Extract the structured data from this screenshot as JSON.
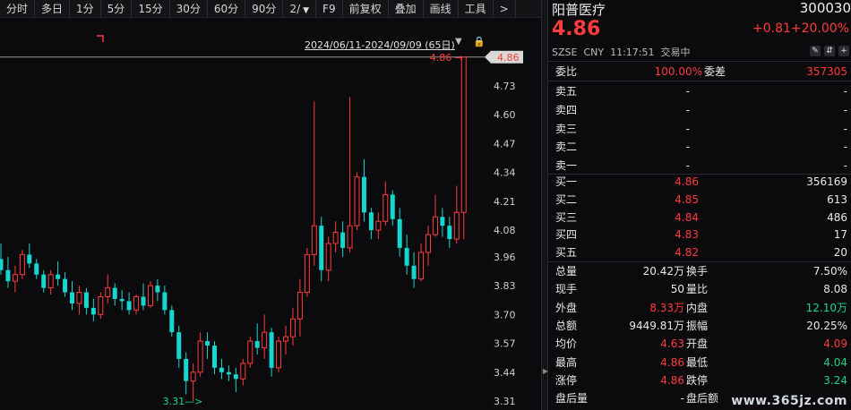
{
  "toolbar": {
    "items": [
      "分时",
      "多日",
      "1分",
      "5分",
      "15分",
      "30分",
      "60分",
      "90分",
      "2/",
      "F9",
      "前复权",
      "叠加",
      "画线",
      "工具",
      ">"
    ]
  },
  "chart": {
    "range_label": "2024/06/11-2024/09/09 (65日)",
    "dropdown_icon": "dropdown-arrow",
    "lock_icon": "lock-icon",
    "current_price_tag": "4.86",
    "high_marker": "4.86",
    "low_marker": "3.31",
    "colors": {
      "up": "#ff3b3b",
      "down": "#16d6d0",
      "background": "#0b0b0d"
    }
  },
  "chart_data": {
    "type": "candlestick",
    "y_ticks": [
      "4.73",
      "4.60",
      "4.47",
      "4.34",
      "4.21",
      "4.08",
      "3.96",
      "3.83",
      "3.70",
      "3.57",
      "3.44",
      "3.31"
    ],
    "ylim": [
      3.27,
      4.9
    ],
    "candles": [
      {
        "o": 3.95,
        "h": 4.02,
        "l": 3.88,
        "c": 3.9
      },
      {
        "o": 3.9,
        "h": 3.96,
        "l": 3.82,
        "c": 3.85
      },
      {
        "o": 3.85,
        "h": 3.92,
        "l": 3.8,
        "c": 3.88
      },
      {
        "o": 3.88,
        "h": 3.99,
        "l": 3.86,
        "c": 3.97
      },
      {
        "o": 3.97,
        "h": 4.02,
        "l": 3.91,
        "c": 3.93
      },
      {
        "o": 3.93,
        "h": 3.95,
        "l": 3.86,
        "c": 3.88
      },
      {
        "o": 3.88,
        "h": 3.9,
        "l": 3.8,
        "c": 3.82
      },
      {
        "o": 3.82,
        "h": 3.9,
        "l": 3.79,
        "c": 3.88
      },
      {
        "o": 3.88,
        "h": 3.94,
        "l": 3.83,
        "c": 3.86
      },
      {
        "o": 3.86,
        "h": 3.89,
        "l": 3.78,
        "c": 3.8
      },
      {
        "o": 3.8,
        "h": 3.85,
        "l": 3.72,
        "c": 3.75
      },
      {
        "o": 3.75,
        "h": 3.83,
        "l": 3.7,
        "c": 3.8
      },
      {
        "o": 3.8,
        "h": 3.82,
        "l": 3.7,
        "c": 3.73
      },
      {
        "o": 3.73,
        "h": 3.77,
        "l": 3.67,
        "c": 3.7
      },
      {
        "o": 3.7,
        "h": 3.8,
        "l": 3.68,
        "c": 3.78
      },
      {
        "o": 3.78,
        "h": 3.88,
        "l": 3.75,
        "c": 3.82
      },
      {
        "o": 3.82,
        "h": 3.84,
        "l": 3.74,
        "c": 3.77
      },
      {
        "o": 3.77,
        "h": 3.81,
        "l": 3.72,
        "c": 3.76
      },
      {
        "o": 3.76,
        "h": 3.8,
        "l": 3.7,
        "c": 3.72
      },
      {
        "o": 3.72,
        "h": 3.79,
        "l": 3.7,
        "c": 3.78
      },
      {
        "o": 3.78,
        "h": 3.84,
        "l": 3.72,
        "c": 3.74
      },
      {
        "o": 3.74,
        "h": 3.85,
        "l": 3.73,
        "c": 3.83
      },
      {
        "o": 3.83,
        "h": 3.86,
        "l": 3.76,
        "c": 3.8
      },
      {
        "o": 3.8,
        "h": 3.83,
        "l": 3.7,
        "c": 3.72
      },
      {
        "o": 3.72,
        "h": 3.74,
        "l": 3.6,
        "c": 3.62
      },
      {
        "o": 3.62,
        "h": 3.65,
        "l": 3.46,
        "c": 3.5
      },
      {
        "o": 3.5,
        "h": 3.53,
        "l": 3.34,
        "c": 3.4
      },
      {
        "o": 3.4,
        "h": 3.48,
        "l": 3.31,
        "c": 3.44
      },
      {
        "o": 3.44,
        "h": 3.62,
        "l": 3.42,
        "c": 3.58
      },
      {
        "o": 3.58,
        "h": 3.62,
        "l": 3.5,
        "c": 3.56
      },
      {
        "o": 3.56,
        "h": 3.58,
        "l": 3.43,
        "c": 3.46
      },
      {
        "o": 3.46,
        "h": 3.5,
        "l": 3.41,
        "c": 3.44
      },
      {
        "o": 3.44,
        "h": 3.47,
        "l": 3.4,
        "c": 3.43
      },
      {
        "o": 3.43,
        "h": 3.46,
        "l": 3.35,
        "c": 3.41
      },
      {
        "o": 3.41,
        "h": 3.5,
        "l": 3.38,
        "c": 3.48
      },
      {
        "o": 3.48,
        "h": 3.6,
        "l": 3.46,
        "c": 3.58
      },
      {
        "o": 3.58,
        "h": 3.66,
        "l": 3.52,
        "c": 3.55
      },
      {
        "o": 3.55,
        "h": 3.7,
        "l": 3.5,
        "c": 3.62
      },
      {
        "o": 3.62,
        "h": 3.64,
        "l": 3.42,
        "c": 3.46
      },
      {
        "o": 3.46,
        "h": 3.6,
        "l": 3.44,
        "c": 3.58
      },
      {
        "o": 3.58,
        "h": 3.65,
        "l": 3.52,
        "c": 3.6
      },
      {
        "o": 3.6,
        "h": 3.73,
        "l": 3.56,
        "c": 3.68
      },
      {
        "o": 3.68,
        "h": 3.86,
        "l": 3.6,
        "c": 3.8
      },
      {
        "o": 3.8,
        "h": 4.0,
        "l": 3.78,
        "c": 3.97
      },
      {
        "o": 3.97,
        "h": 4.66,
        "l": 3.92,
        "c": 4.1
      },
      {
        "o": 4.1,
        "h": 4.14,
        "l": 3.85,
        "c": 3.9
      },
      {
        "o": 3.9,
        "h": 4.05,
        "l": 3.85,
        "c": 4.02
      },
      {
        "o": 4.02,
        "h": 4.12,
        "l": 3.98,
        "c": 4.07
      },
      {
        "o": 4.07,
        "h": 4.12,
        "l": 3.96,
        "c": 4.0
      },
      {
        "o": 4.0,
        "h": 4.68,
        "l": 3.98,
        "c": 4.1
      },
      {
        "o": 4.1,
        "h": 4.34,
        "l": 4.08,
        "c": 4.32
      },
      {
        "o": 4.32,
        "h": 4.4,
        "l": 4.12,
        "c": 4.16
      },
      {
        "o": 4.16,
        "h": 4.18,
        "l": 4.04,
        "c": 4.08
      },
      {
        "o": 4.08,
        "h": 4.16,
        "l": 4.04,
        "c": 4.12
      },
      {
        "o": 4.12,
        "h": 4.3,
        "l": 4.1,
        "c": 4.24
      },
      {
        "o": 4.24,
        "h": 4.26,
        "l": 4.1,
        "c": 4.13
      },
      {
        "o": 4.13,
        "h": 4.18,
        "l": 3.96,
        "c": 4.0
      },
      {
        "o": 4.0,
        "h": 4.06,
        "l": 3.88,
        "c": 3.92
      },
      {
        "o": 3.92,
        "h": 3.98,
        "l": 3.82,
        "c": 3.86
      },
      {
        "o": 3.86,
        "h": 4.02,
        "l": 3.85,
        "c": 3.98
      },
      {
        "o": 3.98,
        "h": 4.1,
        "l": 3.92,
        "c": 4.06
      },
      {
        "o": 4.06,
        "h": 4.24,
        "l": 4.05,
        "c": 4.14
      },
      {
        "o": 4.14,
        "h": 4.18,
        "l": 4.05,
        "c": 4.1
      },
      {
        "o": 4.1,
        "h": 4.14,
        "l": 4.0,
        "c": 4.04
      },
      {
        "o": 4.04,
        "h": 4.28,
        "l": 4.02,
        "c": 4.16
      },
      {
        "o": 4.16,
        "h": 4.86,
        "l": 4.04,
        "c": 4.86
      }
    ]
  },
  "panel": {
    "name": "阳普医疗",
    "code": "300030",
    "price": "4.86",
    "change": "+0.81",
    "change_pct": "+20.00%",
    "exchange": "SZSE",
    "currency": "CNY",
    "time": "11:17:51",
    "status": "交易中",
    "icons": [
      "edit-icon",
      "drag-icon",
      "add-icon"
    ],
    "ratio": {
      "label": "委比",
      "value": "100.00%",
      "diff_label": "委差",
      "diff_value": "357305"
    },
    "asks": [
      {
        "label": "卖五",
        "price": "-",
        "vol": "-"
      },
      {
        "label": "卖四",
        "price": "-",
        "vol": "-"
      },
      {
        "label": "卖三",
        "price": "-",
        "vol": "-"
      },
      {
        "label": "卖二",
        "price": "-",
        "vol": "-"
      },
      {
        "label": "卖一",
        "price": "-",
        "vol": "-"
      }
    ],
    "bids": [
      {
        "label": "买一",
        "price": "4.86",
        "vol": "356169"
      },
      {
        "label": "买二",
        "price": "4.85",
        "vol": "613"
      },
      {
        "label": "买三",
        "price": "4.84",
        "vol": "486"
      },
      {
        "label": "买四",
        "price": "4.83",
        "vol": "17"
      },
      {
        "label": "买五",
        "price": "4.82",
        "vol": "20"
      }
    ],
    "stats": [
      {
        "l1": "总量",
        "v1": "20.42万",
        "c1": "white",
        "l2": "换手",
        "v2": "7.50%",
        "c2": "white"
      },
      {
        "l1": "现手",
        "v1": "50",
        "c1": "white",
        "l2": "量比",
        "v2": "8.08",
        "c2": "white"
      },
      {
        "l1": "外盘",
        "v1": "8.33万",
        "c1": "red",
        "l2": "内盘",
        "v2": "12.10万",
        "c2": "green"
      },
      {
        "l1": "总额",
        "v1": "9449.81万",
        "c1": "white",
        "l2": "振幅",
        "v2": "20.25%",
        "c2": "white"
      },
      {
        "l1": "均价",
        "v1": "4.63",
        "c1": "red",
        "l2": "开盘",
        "v2": "4.09",
        "c2": "red"
      },
      {
        "l1": "最高",
        "v1": "4.86",
        "c1": "red",
        "l2": "最低",
        "v2": "4.04",
        "c2": "green"
      },
      {
        "l1": "涨停",
        "v1": "4.86",
        "c1": "red",
        "l2": "跌停",
        "v2": "3.24",
        "c2": "green"
      },
      {
        "l1": "盘后量",
        "v1": "-",
        "c1": "white",
        "l2": "盘后额",
        "v2": "",
        "c2": "white"
      }
    ],
    "watermark": "www.365jz.com"
  }
}
